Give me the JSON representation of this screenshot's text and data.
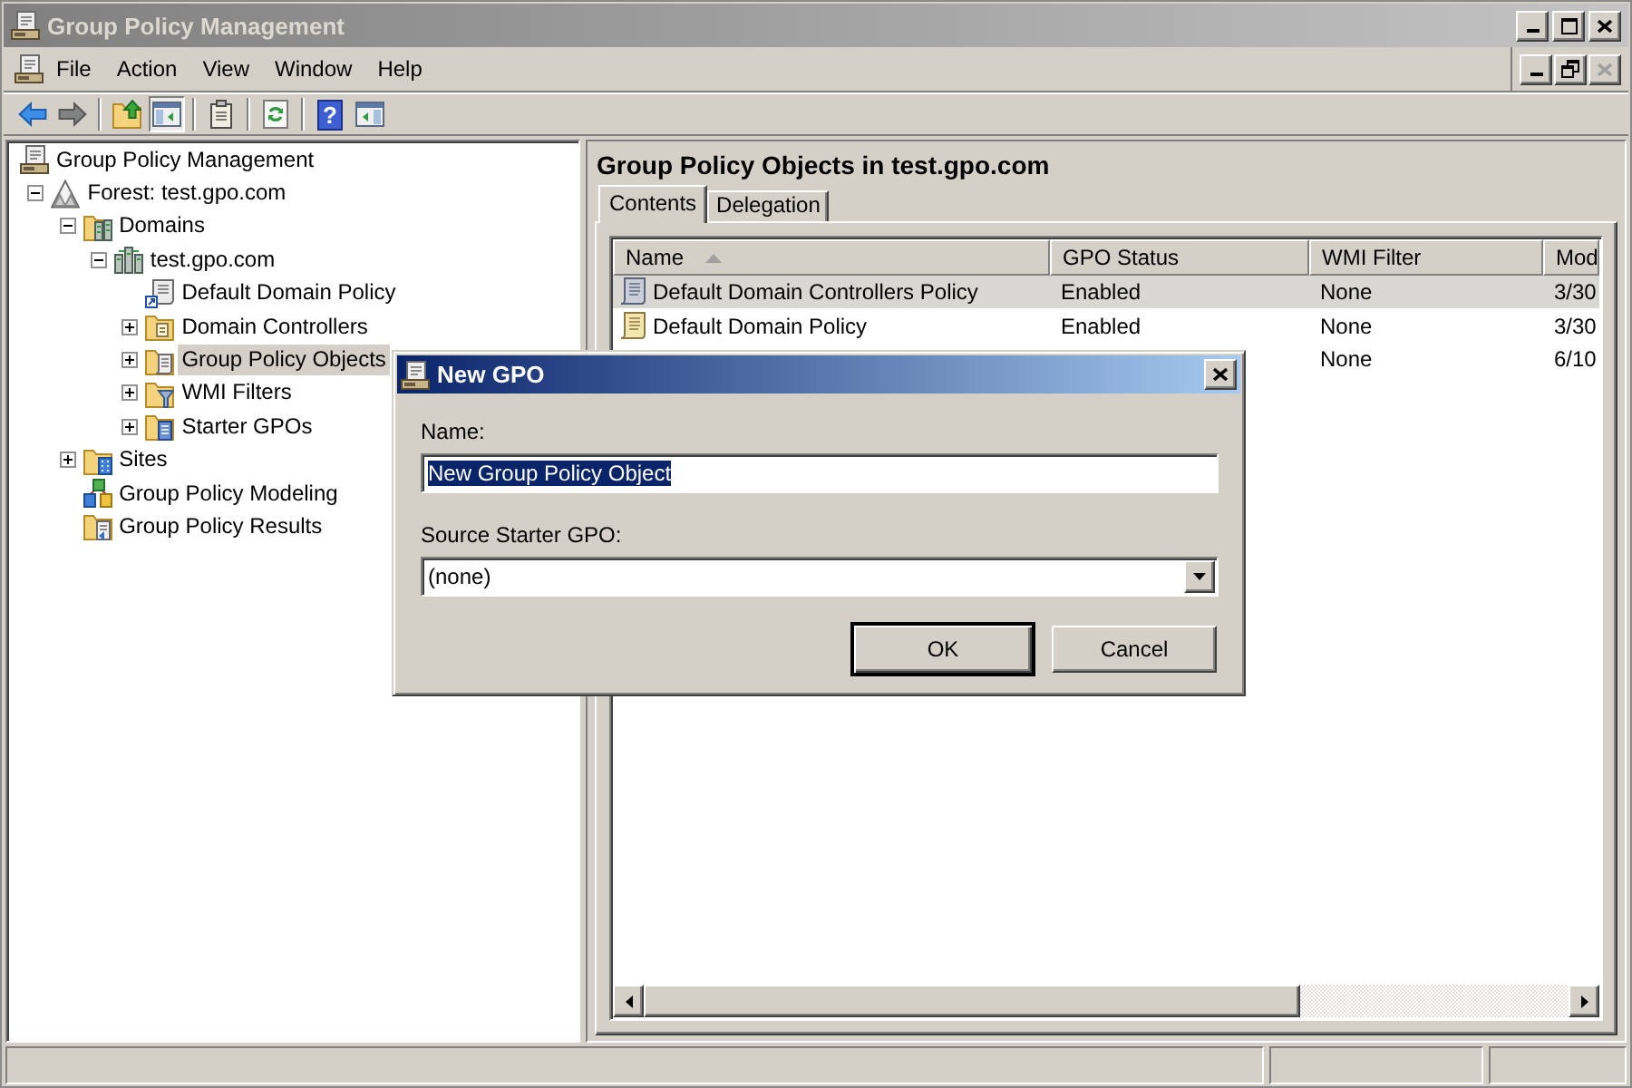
{
  "window": {
    "title": "Group Policy Management",
    "active": false
  },
  "menu": {
    "items": [
      "File",
      "Action",
      "View",
      "Window",
      "Help"
    ]
  },
  "mdi_buttons": [
    {
      "kind": "minimize",
      "disabled": false
    },
    {
      "kind": "restore",
      "disabled": false
    },
    {
      "kind": "close",
      "disabled": true
    }
  ],
  "toolbar": [
    {
      "kind": "back",
      "disabled": false,
      "pressed": false
    },
    {
      "kind": "forward",
      "disabled": true,
      "pressed": false
    },
    {
      "kind": "separator"
    },
    {
      "kind": "up",
      "disabled": false,
      "pressed": false
    },
    {
      "kind": "tree",
      "disabled": false,
      "pressed": true
    },
    {
      "kind": "separator"
    },
    {
      "kind": "export",
      "disabled": false,
      "pressed": false
    },
    {
      "kind": "separator"
    },
    {
      "kind": "refresh",
      "disabled": false,
      "pressed": false
    },
    {
      "kind": "separator"
    },
    {
      "kind": "help",
      "glyph": "?",
      "disabled": false,
      "pressed": false
    },
    {
      "kind": "pane",
      "disabled": false,
      "pressed": false
    }
  ],
  "tree": [
    {
      "label": "Group Policy Management",
      "kind": "console",
      "selected": false,
      "children": [
        {
          "label": "Forest: test.gpo.com",
          "kind": "forest",
          "expanded": true,
          "selected": false,
          "children": [
            {
              "label": "Domains",
              "kind": "domains",
              "expanded": true,
              "selected": false,
              "children": [
                {
                  "label": "test.gpo.com",
                  "kind": "domain",
                  "expanded": true,
                  "selected": false,
                  "children": [
                    {
                      "label": "Default Domain Policy",
                      "kind": "gpolink",
                      "selected": false
                    },
                    {
                      "label": "Domain Controllers",
                      "kind": "ou",
                      "expanded": false,
                      "selected": false
                    },
                    {
                      "label": "Group Policy Objects",
                      "kind": "gpos",
                      "expanded": false,
                      "selected": true
                    },
                    {
                      "label": "WMI Filters",
                      "kind": "wmi",
                      "expanded": false,
                      "selected": false
                    },
                    {
                      "label": "Starter GPOs",
                      "kind": "starters",
                      "expanded": false,
                      "selected": false
                    }
                  ]
                }
              ]
            },
            {
              "label": "Sites",
              "kind": "sites",
              "expanded": false,
              "selected": false
            },
            {
              "label": "Group Policy Modeling",
              "kind": "modeling",
              "selected": false
            },
            {
              "label": "Group Policy Results",
              "kind": "results",
              "selected": false
            }
          ]
        }
      ]
    }
  ],
  "details": {
    "title": "Group Policy Objects in test.gpo.com",
    "tabs": [
      {
        "label": "Contents",
        "selected": true
      },
      {
        "label": "Delegation",
        "selected": false
      }
    ],
    "table": {
      "columns": [
        {
          "label": "Name",
          "sorted": true
        },
        {
          "label": "GPO Status",
          "sorted": false
        },
        {
          "label": "WMI Filter",
          "sorted": false
        },
        {
          "label": "Mod",
          "sorted": false
        }
      ],
      "rows": [
        {
          "name": "Default Domain Controllers Policy",
          "gpo_status": "Enabled",
          "wmi_filter": "None",
          "column_4": "3/30",
          "selected": true
        },
        {
          "name": "Default Domain Policy",
          "gpo_status": "Enabled",
          "wmi_filter": "None",
          "column_4": "3/30",
          "selected": false
        },
        {
          "wmi_filter": "None",
          "column_4": "6/10",
          "selected": false
        }
      ]
    }
  },
  "dialog": {
    "title": "New GPO",
    "active": true,
    "name_label": "Name:",
    "name_value": "New Group Policy Object",
    "name_value_selected": true,
    "starter_label": "Source Starter GPO:",
    "starter_value": "(none)",
    "buttons": [
      {
        "label": "OK",
        "default": true
      },
      {
        "label": "Cancel",
        "default": false
      }
    ]
  }
}
